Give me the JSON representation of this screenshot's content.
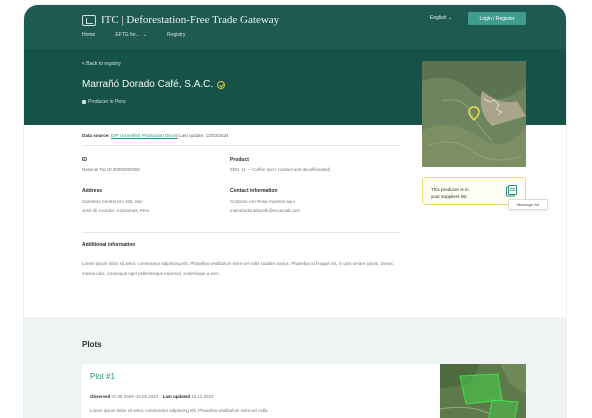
{
  "header": {
    "brand": "ITC | Deforestation-Free Trade Gateway",
    "nav": [
      "Home",
      "EFTG for...",
      "Registry"
    ],
    "language": "English",
    "login_label": "Login / Register"
  },
  "hero": {
    "back_label": "< Back to registry",
    "title": "Marrañó Dorado Café, S.A.C.",
    "subtitle": "Producer in Peru"
  },
  "details": {
    "ref_prefix": "Data source:",
    "ref_link": "DIF Unverified Production Discrit",
    "ref_suffix": "Last update: 12/03/2024",
    "id_label": "ID",
    "id_value": "National Tax ID 80050050050",
    "product_label": "Product",
    "product_value": "0901 11 — Coffee (excl. roasted and decaffeinated)",
    "address_label": "Address",
    "address_value": [
      "Carretera Central Km 165, San",
      "José de Lourdes, Amazonas, Peru"
    ],
    "contact_label": "Contact information",
    "contact_value": [
      "Contacto con Rosa Huamán aquí",
      "marranodoradocafe@ecoamail.com"
    ],
    "additional_label": "Additional information",
    "additional_text": "Lorem ipsum dolor sit amet, consectetur adipiscing elit. Phasellus vestibulum enim vel nulla sodales varius. Phasellus id feugiat est, in quis ornare ipsum. Donec massa odio, consequat eget pellentesque euismod, scelerisque a sem."
  },
  "supplier": {
    "text": [
      "This producer is in",
      "your suppliers list."
    ],
    "tooltip": "Message list"
  },
  "plots": {
    "title": "Plots",
    "items": [
      {
        "name": "Plot #1",
        "observed_label": "Observed",
        "observed_value": "01.06.2023–15.06.2023",
        "updated_label": "Last updated",
        "updated_value": "15.12.2023",
        "description": "Lorem ipsum dolor sit amet, consectetur adipiscing elit. Phasellus vestibulum enim vel nulla"
      }
    ]
  },
  "colors": {
    "header_green": "#1f5a52",
    "accent_teal": "#2d8f80",
    "highlight_yellow": "#e8e06a"
  }
}
